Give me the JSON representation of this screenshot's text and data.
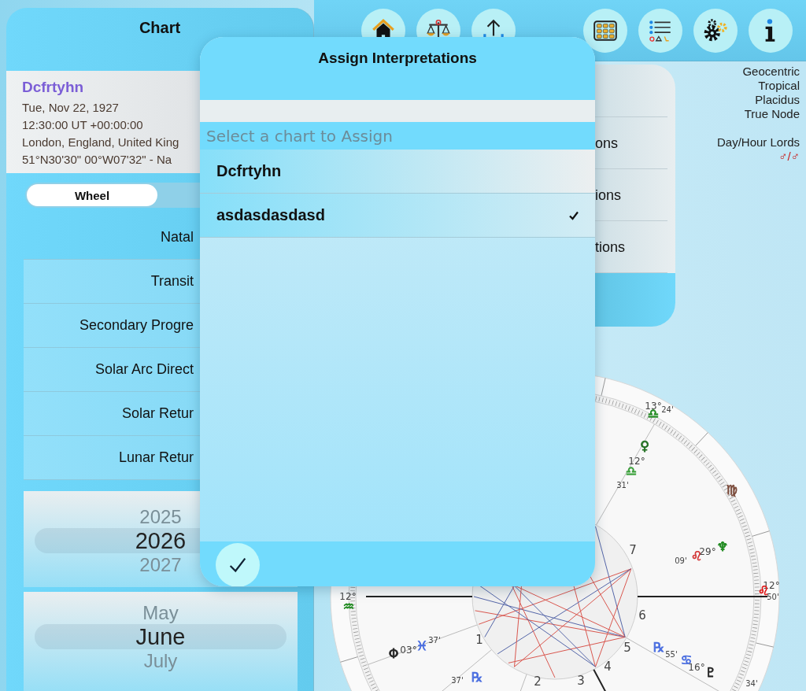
{
  "toolbar": {
    "buttons": [
      {
        "kind": "home"
      },
      {
        "kind": "scales"
      },
      {
        "kind": "share"
      },
      {
        "kind": "grid"
      },
      {
        "kind": "list"
      },
      {
        "kind": "settings"
      },
      {
        "kind": "info"
      }
    ]
  },
  "sidebar": {
    "title": "Chart",
    "person": {
      "name": "Dcfrtyhn",
      "lines": [
        "Tue, Nov 22, 1927",
        "12:30:00 UT +00:00:00",
        "London, England, United King",
        "51°N30'30\" 00°W07'32\" - Na"
      ]
    },
    "segments": [
      {
        "label": "Wheel",
        "selected": true
      }
    ],
    "items": [
      "Natal",
      "Transit",
      "Secondary Progre",
      "Solar Arc Direct",
      "Solar Retur",
      "Lunar Retur"
    ],
    "year_picker": [
      {
        "label": "2025",
        "selected": false
      },
      {
        "label": "2026",
        "selected": true
      },
      {
        "label": "2027",
        "selected": false
      }
    ],
    "month_picker": [
      {
        "label": "May",
        "selected": false
      },
      {
        "label": "June",
        "selected": true
      },
      {
        "label": "July",
        "selected": false
      }
    ]
  },
  "menu": {
    "items": [
      "ons",
      "ions",
      "tions"
    ]
  },
  "chart_info": {
    "lines": [
      "Geocentric",
      "Tropical",
      "Placidus",
      "True Node"
    ],
    "lords_label": "Day/Hour Lords",
    "lords": "♂/♂"
  },
  "wheel": {
    "labels": [
      {
        "text": "13°",
        "kind": "degree"
      },
      {
        "text": "♎",
        "kind": "glyph",
        "color": "#1f8a1f"
      },
      {
        "text": "24'",
        "kind": "minute"
      },
      {
        "text": "♀",
        "kind": "glyph",
        "color": "#1f6e1f"
      },
      {
        "text": "12°",
        "kind": "degree"
      },
      {
        "text": "♎",
        "kind": "glyph",
        "color": "#3aa03a"
      },
      {
        "text": "31'",
        "kind": "minute"
      },
      {
        "text": "♍",
        "kind": "glyph",
        "color": "#7a4a3a"
      },
      {
        "text": "♆",
        "kind": "glyph",
        "color": "#1f8a1f"
      },
      {
        "text": "29°",
        "kind": "degree"
      },
      {
        "text": "♌",
        "kind": "glyph",
        "color": "#d43a3a"
      },
      {
        "text": "09'",
        "kind": "minute"
      },
      {
        "text": "12°",
        "kind": "degree"
      },
      {
        "text": "♌",
        "kind": "glyph",
        "color": "#e02020"
      },
      {
        "text": "50'",
        "kind": "minute"
      },
      {
        "text": "12°",
        "kind": "degree"
      },
      {
        "text": "♒",
        "kind": "glyph",
        "color": "#1f8a1f"
      },
      {
        "text": "Φ",
        "kind": "glyph",
        "color": "#222222"
      },
      {
        "text": "03°",
        "kind": "degree"
      },
      {
        "text": "♓",
        "kind": "glyph",
        "color": "#4a6ee0"
      },
      {
        "text": "37'",
        "kind": "minute"
      },
      {
        "text": "℞",
        "kind": "glyph",
        "color": "#4a6ee0"
      },
      {
        "text": "55'",
        "kind": "minute"
      },
      {
        "text": "♋",
        "kind": "glyph",
        "color": "#4a6ee0"
      },
      {
        "text": "16°",
        "kind": "degree"
      },
      {
        "text": "♇",
        "kind": "glyph",
        "color": "#222222"
      },
      {
        "text": "34'",
        "kind": "minute"
      },
      {
        "text": "37'",
        "kind": "minute"
      },
      {
        "text": "℞",
        "kind": "glyph",
        "color": "#4a6ee0"
      },
      {
        "text": "1",
        "kind": "house"
      },
      {
        "text": "2",
        "kind": "house"
      },
      {
        "text": "3",
        "kind": "house"
      },
      {
        "text": "4",
        "kind": "house"
      },
      {
        "text": "5",
        "kind": "house"
      },
      {
        "text": "6",
        "kind": "house"
      },
      {
        "text": "7",
        "kind": "house"
      }
    ]
  },
  "dialog": {
    "title": "Assign Interpretations",
    "section": "Select a chart to Assign",
    "rows": [
      {
        "label": "Dcfrtyhn",
        "selected": false
      },
      {
        "label": "asdasdasdasd",
        "selected": true
      }
    ]
  }
}
